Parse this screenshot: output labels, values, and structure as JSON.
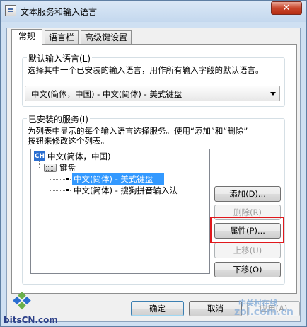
{
  "window": {
    "title": "文本服务和输入语言",
    "close_label": "✕"
  },
  "tabs": [
    {
      "label": "常规",
      "active": true
    },
    {
      "label": "语言栏",
      "active": false
    },
    {
      "label": "高级键设置",
      "active": false
    }
  ],
  "default_language": {
    "group_label": "默认输入语言(L)",
    "description": "选择其中一个已安装的输入语言，用作所有输入字段的默认语言。",
    "selected": "中文(简体，中国) - 中文(简体) - 美式键盘"
  },
  "installed_services": {
    "group_label": "已安装的服务(I)",
    "description_line1": "为列表中显示的每个输入语言选择服务。使用“添加”和“删除”",
    "description_line2": "按钮来修改这个列表。",
    "tree": {
      "language": {
        "icon_text": "CH",
        "label": "中文(简体，中国)"
      },
      "category": {
        "label": "键盘"
      },
      "items": [
        {
          "label": "中文(简体) - 美式键盘",
          "selected": true
        },
        {
          "label": "中文(简体) - 搜狗拼音输入法",
          "selected": false
        }
      ]
    },
    "buttons": {
      "add": "添加(D)...",
      "remove": "删除(R)",
      "properties": "属性(P)...",
      "move_up": "上移(U)",
      "move_down": "下移(O)"
    }
  },
  "footer": {
    "ok": "确定",
    "cancel": "取消",
    "apply": "应用(A)"
  },
  "watermarks": {
    "left_logo_text": "bitsCN.com",
    "right_line1": "中关村在线",
    "right_line2": "zol.com.cn"
  },
  "colors": {
    "selection": "#3399ff",
    "highlight_box": "#e0181c",
    "window_frame": "#cfe0f2"
  }
}
